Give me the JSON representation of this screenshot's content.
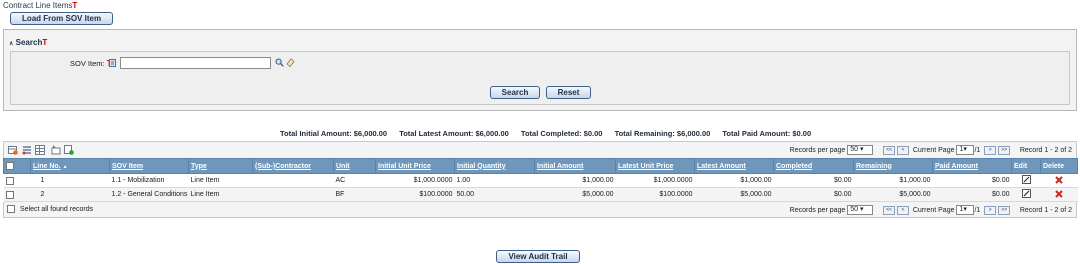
{
  "header": {
    "title": "Contract Line Items",
    "required_mark": "T",
    "load_button": "Load From SOV Item"
  },
  "search": {
    "section_title": "Search",
    "section_mark": "T",
    "sov_label": "SOV Item:",
    "sov_mark": "T",
    "sov_value": "",
    "search_button": "Search",
    "reset_button": "Reset"
  },
  "totals": {
    "initial": "Total Initial Amount: $6,000.00",
    "latest": "Total Latest Amount: $6,000.00",
    "completed": "Total Completed: $0.00",
    "remaining": "Total Remaining: $6,000.00",
    "paid": "Total Paid Amount: $0.00"
  },
  "pager": {
    "records_per_page_label": "Records per page",
    "records_per_page_value": "50",
    "first": "<<",
    "prev": "<",
    "current_page_label": "Current Page",
    "current_page_value": "1",
    "total_pages": "/1",
    "next": ">",
    "last": ">>",
    "record_info": "Record 1 - 2 of 2"
  },
  "columns": {
    "line_no": "Line No.",
    "sort_indicator": "▲",
    "sov_item": "SOV Item",
    "type": "Type",
    "sub_contractor": "(Sub-)Contractor",
    "unit": "Unit",
    "initial_unit_price": "Initial Unit Price",
    "initial_quantity": "Initial Quantity",
    "initial_amount": "Initial Amount",
    "latest_unit_price": "Latest Unit Price",
    "latest_amount": "Latest Amount",
    "completed": "Completed",
    "remaining": "Remaining",
    "paid_amount": "Paid Amount",
    "edit": "Edit",
    "delete": "Delete"
  },
  "rows": [
    {
      "line_no": "1",
      "sov_item": "1.1 - Mobilization",
      "type": "Line Item",
      "sub_contractor": "",
      "unit": "AC",
      "initial_unit_price": "$1,000.0000",
      "initial_quantity": "1.00",
      "initial_amount": "$1,000.00",
      "latest_unit_price": "$1,000.0000",
      "latest_amount": "$1,000.00",
      "completed": "$0.00",
      "remaining": "$1,000.00",
      "paid_amount": "$0.00"
    },
    {
      "line_no": "2",
      "sov_item": "1.2 - General Conditions",
      "type": "Line Item",
      "sub_contractor": "",
      "unit": "BF",
      "initial_unit_price": "$100.0000",
      "initial_quantity": "50.00",
      "initial_amount": "$5,000.00",
      "latest_unit_price": "$100.0000",
      "latest_amount": "$5,000.00",
      "completed": "$0.00",
      "remaining": "$5,000.00",
      "paid_amount": "$0.00"
    }
  ],
  "footer": {
    "select_all_label": "Select all found records",
    "audit_button": "View Audit Trail"
  },
  "colors": {
    "header_bg": "#6f97bb",
    "delete_icon": "#d0281b",
    "required_mark": "#c00000"
  },
  "icons": [
    "add-row-icon",
    "list-icon",
    "grid-edit-icon",
    "import-icon",
    "export-icon",
    "search-icon",
    "eraser-icon",
    "lookup-icon",
    "edit-icon",
    "delete-icon"
  ]
}
